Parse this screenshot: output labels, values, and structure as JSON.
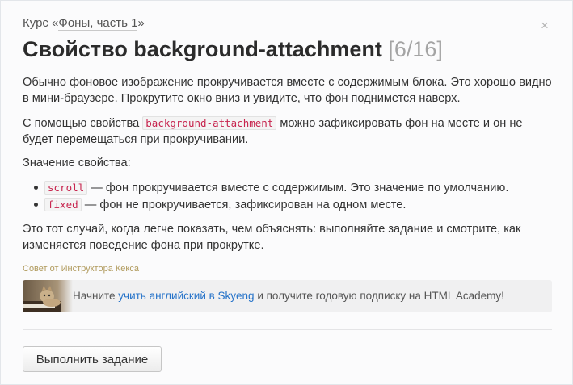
{
  "header": {
    "course_prefix": "Курс «",
    "course_name": "Фоны, часть 1",
    "course_suffix": "»",
    "close_label": "×",
    "title": "Свойство background-attachment",
    "progress": "[6/16]"
  },
  "body": {
    "p1": "Обычно фоновое изображение прокручивается вместе с содержимым блока. Это хорошо видно в мини-браузере. Прокрутите окно вниз и увидите, что фон поднимется наверх.",
    "p2_before": "С помощью свойства ",
    "p2_code": "background-attachment",
    "p2_after": " можно зафиксировать фон на месте и он не будет перемещаться при прокручивании.",
    "p3": "Значение свойства:",
    "values": [
      {
        "code": "scroll",
        "text": " — фон прокручивается вместе с содержимым. Это значение по умолчанию."
      },
      {
        "code": "fixed",
        "text": " — фон не прокручивается, зафиксирован на одном месте."
      }
    ],
    "p4": "Это тот случай, когда легче показать, чем объяснять: выполняйте задание и смотрите, как изменяется поведение фона при прокрутке."
  },
  "tip": {
    "label": "Совет от Инструктора Кекса",
    "text_before": "Начните ",
    "link": "учить английский в Skyeng",
    "text_after": " и получите годовую подписку на HTML Academy!",
    "image_icon": "cat-photo"
  },
  "actions": {
    "submit_label": "Выполнить задание"
  },
  "colors": {
    "code_text": "#c7254e",
    "link": "#2673c9",
    "tip_label": "#b09a5c"
  }
}
